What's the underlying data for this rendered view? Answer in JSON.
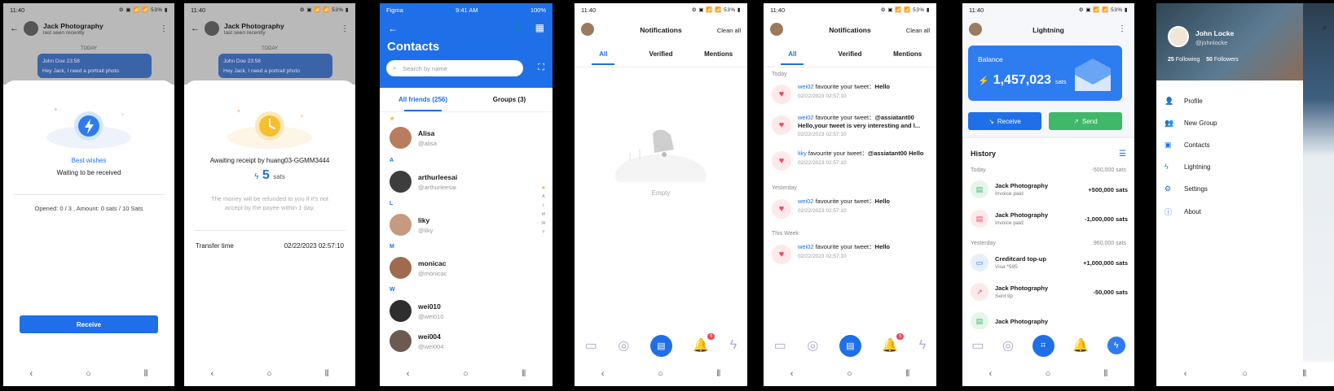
{
  "status": {
    "time": "11:40",
    "right": "⚙ ▣ 📶 📶 53% ▮",
    "figma_left": "Figma",
    "figma_time": "9:41 AM",
    "figma_right": "100%"
  },
  "chat": {
    "name": "Jack Photography",
    "last_seen": "last seen recently",
    "today": "TODAY",
    "bubble_sender": "John Doe",
    "bubble_time": "23:58",
    "bubble_text": "Hey Jack, I need a portrait photo"
  },
  "screen1": {
    "title": "Best wishes",
    "subtitle": "Waiting to be received",
    "info": "Opened: 0 / 3 , Amount: 0 sats / 10 Sats",
    "button": "Receive"
  },
  "screen2": {
    "awaiting": "Awaiting receipt by huang03-GGMM3444",
    "amount": "5",
    "unit": "sats",
    "note": "The money will be refunded to you if it's not accept by the payee within 1 day.",
    "transfer_label": "Transfer time",
    "transfer_value": "02/22/2023 02:57:10"
  },
  "contacts": {
    "title": "Contacts",
    "search_placeholder": "Search by name",
    "tab_friends": "All friends  (256)",
    "tab_groups": "Groups  (3)",
    "star": "★",
    "letters": [
      "A",
      "L",
      "M",
      "W"
    ],
    "items": [
      {
        "name": "Alisa",
        "handle": "@alisa"
      },
      {
        "name": "arthurleesai",
        "handle": "@arthurleesai"
      },
      {
        "name": "liky",
        "handle": "@liky"
      },
      {
        "name": "monicac",
        "handle": "@monicac"
      },
      {
        "name": "wei010",
        "handle": "@wei010"
      },
      {
        "name": "wei004",
        "handle": "@wei004"
      }
    ],
    "index": [
      "★",
      "A",
      "L",
      "M",
      "W",
      "Y"
    ]
  },
  "notifications": {
    "title": "Notifications",
    "clean": "Clean all",
    "tabs": [
      "All",
      "Verified",
      "Mentions"
    ],
    "empty": "Empty",
    "badge": "5",
    "sections": [
      "Today",
      "Yesterday",
      "This Week"
    ],
    "items": [
      {
        "user": "wei02",
        "action": " favourite your tweet：",
        "content": "Hello",
        "time": "02/22/2023 02:57:10"
      },
      {
        "user": "wei02",
        "action": " favourite your tweet：",
        "content": "@assiatant00 Hello,your tweet is very interesting and l...",
        "time": "02/22/2023 02:57:10"
      },
      {
        "user": "liky",
        "action": " favourite your tweet：",
        "content": "@assiatant00 Hello",
        "time": "02/22/2023 02:57:10"
      },
      {
        "user": "wei02",
        "action": " favourite your tweet：",
        "content": "Hello",
        "time": "02/22/2023 02:57:10"
      },
      {
        "user": "wei02",
        "action": " favourite your tweet：",
        "content": "Hello",
        "time": "02/22/2023 02:57:10"
      }
    ]
  },
  "lightning": {
    "title": "Lightning",
    "balance_label": "Balance",
    "balance": "1,457,023",
    "unit": "sats",
    "receive": "Receive",
    "send": "Send",
    "history": "History",
    "groups": [
      {
        "label": "Today",
        "total": "-500,000 sats"
      },
      {
        "label": "Yesterday",
        "total": "960,000 sats"
      }
    ],
    "rows": [
      {
        "title": "Jack Photography",
        "sub": "Invoice paid",
        "amount": "+500,000 sats"
      },
      {
        "title": "Jack Photography",
        "sub": "Invoice paid",
        "amount": "-1,000,000 sats"
      },
      {
        "title": "Creditcard top-up",
        "sub": "Visa *595",
        "amount": "+1,000,000 sats"
      },
      {
        "title": "Jack Photography",
        "sub": "Sent tip",
        "amount": "-50,000 sats"
      },
      {
        "title": "Jack Photography",
        "sub": "",
        "amount": ""
      }
    ]
  },
  "drawer": {
    "name": "John Locke",
    "handle": "@johnlocke",
    "following_count": "25",
    "following_label": "Following",
    "followers_count": "50",
    "followers_label": "Followers",
    "items": [
      "Profile",
      "New Group",
      "Contacts",
      "Lightning",
      "Settings",
      "About"
    ]
  },
  "colors": {
    "accent": "#1f6fe8",
    "send": "#3fb86a",
    "heart": "#e84a5f"
  }
}
